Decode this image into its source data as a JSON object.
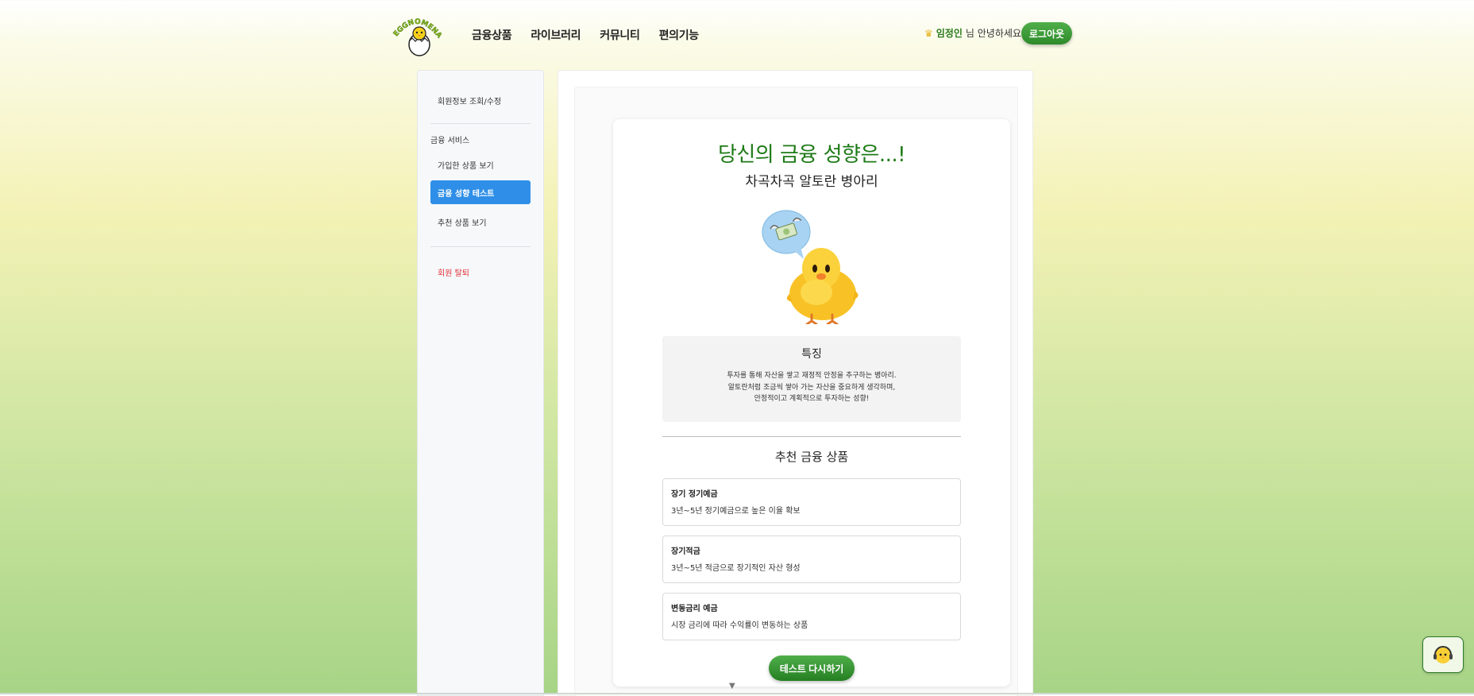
{
  "header": {
    "logo_text": "EGGNOMENA",
    "nav": [
      "금융상품",
      "라이브러리",
      "커뮤니티",
      "편의기능"
    ],
    "greeting_user": "임정인",
    "greeting_suffix": "님 안녕하세요!",
    "logout_label": "로그아웃"
  },
  "sidebar": {
    "profile_link": "회원정보 조회/수정",
    "section_title": "금융 서비스",
    "items": [
      "가입한 상품 보기",
      "금융 성향 테스트",
      "추천 상품 보기"
    ],
    "active_index": 1,
    "withdraw_link": "회원 탈퇴"
  },
  "result": {
    "title": "당신의 금융 성향은...!",
    "type_name": "차곡차곡 알토란 병아리",
    "feature_title": "특징",
    "feature_lines": [
      "투자를 통해 자산을 쌓고 재정적 안정을 추구하는 병아리.",
      "알토란처럼 조금씩 쌓아 가는 자산을 중요하게 생각하며,",
      "안정적이고 계획적으로 투자하는 성향!"
    ],
    "recommend_title": "추천 금융 상품",
    "products": [
      {
        "name": "장기 정기예금",
        "desc": "3년~5년 정기예금으로 높은 이율 확보"
      },
      {
        "name": "장기적금",
        "desc": "3년~5년 적금으로 장기적인 자산 형성"
      },
      {
        "name": "변동금리 예금",
        "desc": "시장 금리에 따라 수익률이 변동하는 상품"
      }
    ],
    "retry_label": "테스트 다시하기"
  },
  "icons": {
    "chick": "hatching-chick-icon",
    "speech": "money-with-wings-icon",
    "helper": "chick-headset-icon",
    "scroll": "scroll-down-icon"
  },
  "colors": {
    "accent_green": "#1e7a17",
    "active_blue": "#2f8fe8",
    "danger_red": "#e0323a"
  }
}
